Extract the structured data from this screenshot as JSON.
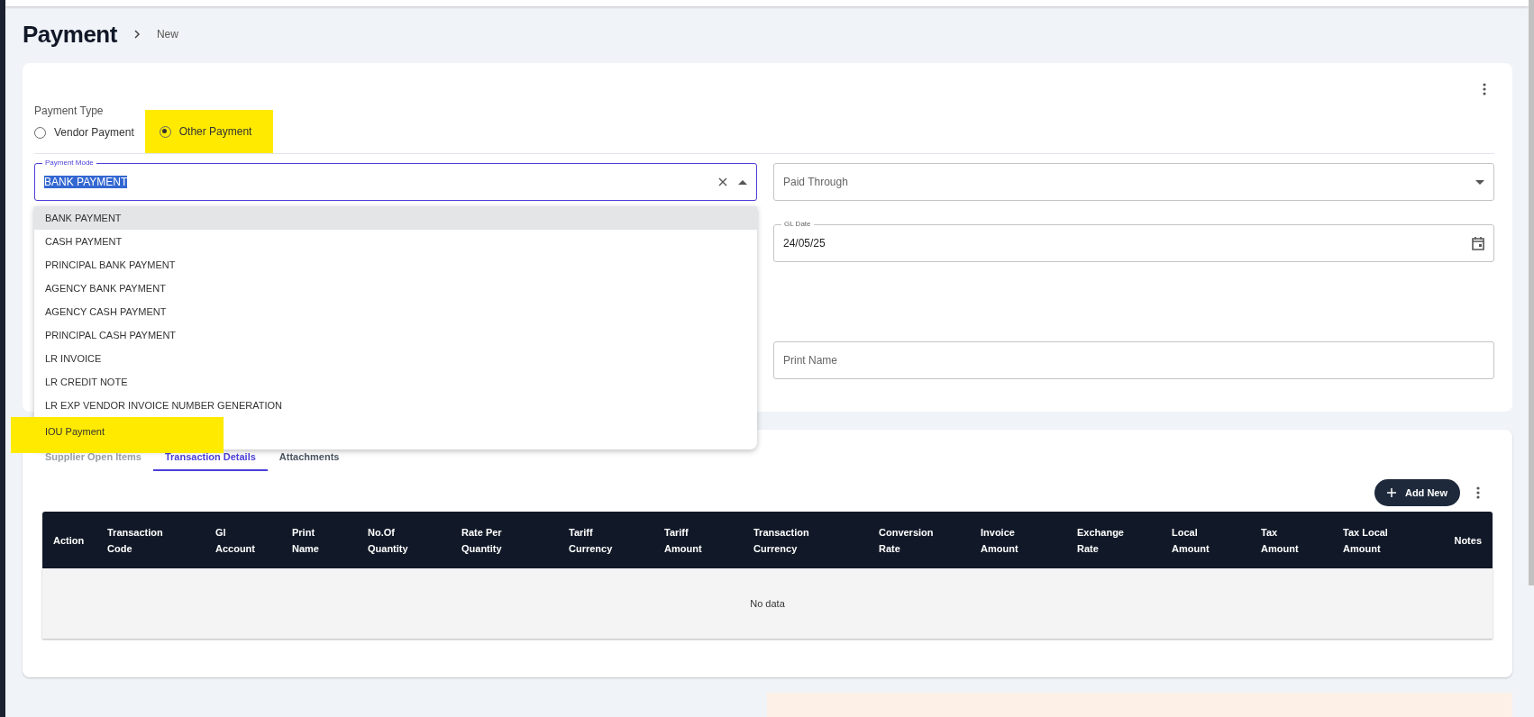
{
  "page": {
    "title": "Payment",
    "breadcrumb": "New"
  },
  "payment_type": {
    "label": "Payment Type",
    "options": [
      {
        "label": "Vendor Payment",
        "selected": false,
        "highlighted": false
      },
      {
        "label": "Other Payment",
        "selected": true,
        "highlighted": true
      }
    ]
  },
  "payment_mode": {
    "label": "Payment Mode",
    "value": "BANK PAYMENT",
    "value_selected": true,
    "expanded": true,
    "options": [
      {
        "label": "BANK PAYMENT",
        "selected": true,
        "highlighted": false
      },
      {
        "label": "CASH PAYMENT",
        "selected": false,
        "highlighted": false
      },
      {
        "label": "PRINCIPAL BANK PAYMENT",
        "selected": false,
        "highlighted": false
      },
      {
        "label": "AGENCY BANK PAYMENT",
        "selected": false,
        "highlighted": false
      },
      {
        "label": "AGENCY CASH PAYMENT",
        "selected": false,
        "highlighted": false
      },
      {
        "label": "PRINCIPAL CASH PAYMENT",
        "selected": false,
        "highlighted": false
      },
      {
        "label": "LR INVOICE",
        "selected": false,
        "highlighted": false
      },
      {
        "label": "LR CREDIT NOTE",
        "selected": false,
        "highlighted": false
      },
      {
        "label": "LR EXP VENDOR INVOICE NUMBER GENERATION",
        "selected": false,
        "highlighted": false
      },
      {
        "label": "IOU Payment",
        "selected": false,
        "highlighted": true
      }
    ]
  },
  "paid_through": {
    "placeholder": "Paid Through"
  },
  "gl_date": {
    "label": "GL Date",
    "value": "24/05/25"
  },
  "print_name": {
    "placeholder": "Print Name"
  },
  "tabs": [
    {
      "label": "Supplier Open Items",
      "selected": false,
      "disabled": true
    },
    {
      "label": "Transaction Details",
      "selected": true,
      "disabled": false
    },
    {
      "label": "Attachments",
      "selected": false,
      "disabled": false
    }
  ],
  "add_button": "Add New",
  "table": {
    "columns": [
      [
        "Action"
      ],
      [
        "Transaction",
        "Code"
      ],
      [
        "Gl",
        "Account"
      ],
      [
        "Print",
        "Name"
      ],
      [
        "No.Of",
        "Quantity"
      ],
      [
        "Rate Per",
        "Quantity"
      ],
      [
        "Tariff",
        "Currency"
      ],
      [
        "Tariff",
        "Amount"
      ],
      [
        "Transaction",
        "Currency"
      ],
      [
        "Conversion",
        "Rate"
      ],
      [
        "Invoice",
        "Amount"
      ],
      [
        "Exchange",
        "Rate"
      ],
      [
        "Local",
        "Amount"
      ],
      [
        "Tax",
        "Amount"
      ],
      [
        "Tax Local",
        "Amount"
      ],
      [
        "Notes"
      ]
    ],
    "empty_text": "No data"
  }
}
